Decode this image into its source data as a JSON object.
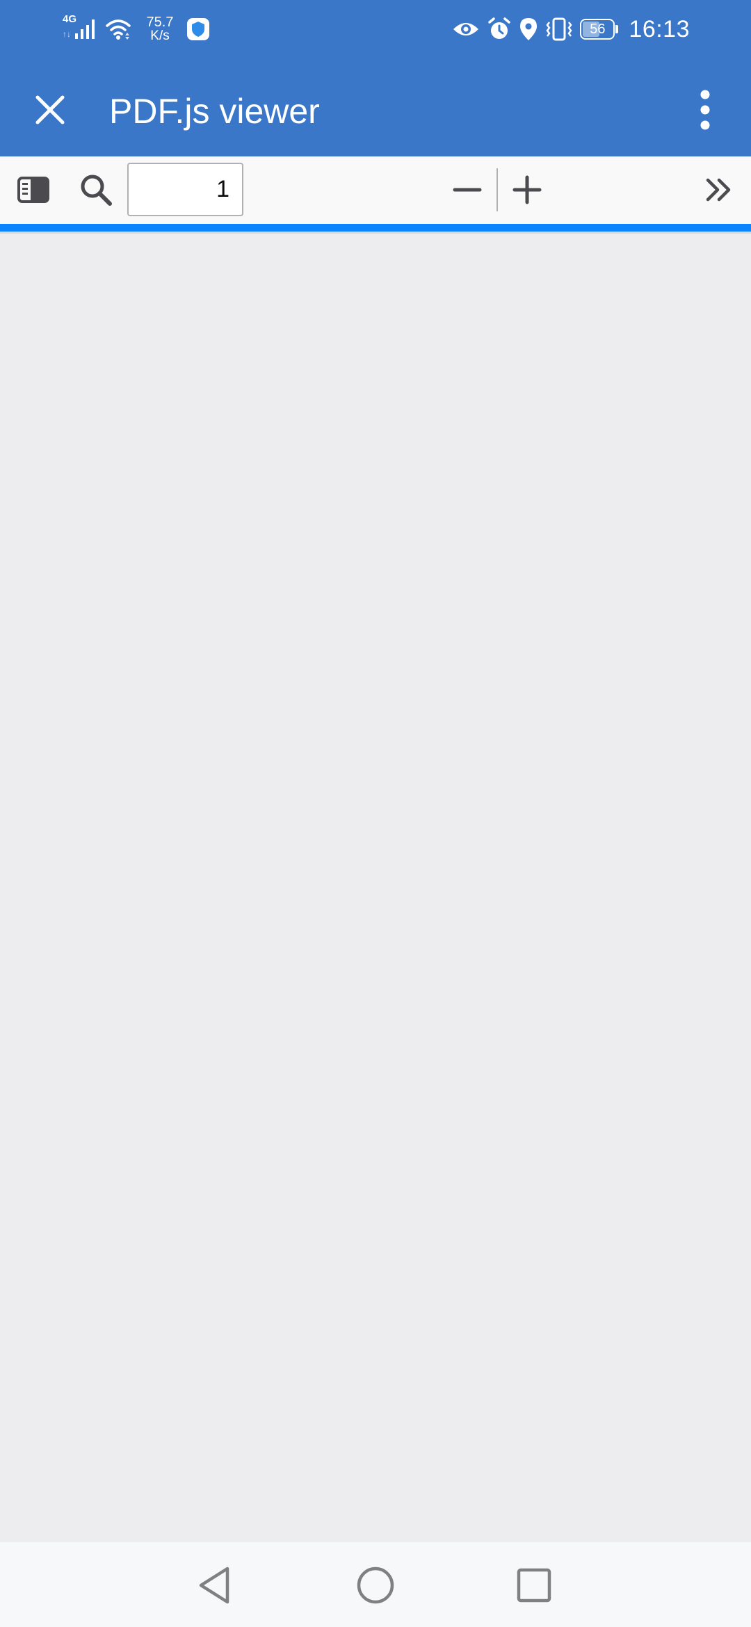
{
  "status_bar": {
    "network_type": "4G",
    "network_arrows": "↑↓",
    "speed_value": "75.7",
    "speed_unit": "K/s",
    "battery_level": "56",
    "time": "16:13",
    "icons": [
      "signal-icon",
      "wifi-icon",
      "shield-app-icon",
      "eye-icon",
      "alarm-icon",
      "location-icon",
      "vibrate-icon",
      "battery-icon"
    ]
  },
  "app_bar": {
    "title": "PDF.js viewer",
    "close_icon": "close-icon",
    "more_icon": "more-vert-icon"
  },
  "toolbar": {
    "sidebar_toggle_icon": "sidebar-toggle-icon",
    "search_icon": "search-icon",
    "page_number": "1",
    "zoom_out_icon": "minus-icon",
    "zoom_in_icon": "plus-icon",
    "more_tools_icon": "double-chevron-right-icon"
  },
  "nav_bar": {
    "back_icon": "back-triangle-icon",
    "home_icon": "home-circle-icon",
    "recents_icon": "recents-square-icon"
  },
  "colors": {
    "app_bar": "#3A77C9",
    "toolbar": "#F9F9FA",
    "progress": "#0A84FF",
    "viewer_background": "#EDEDF0",
    "nav_bar": "#F7F8FA"
  }
}
